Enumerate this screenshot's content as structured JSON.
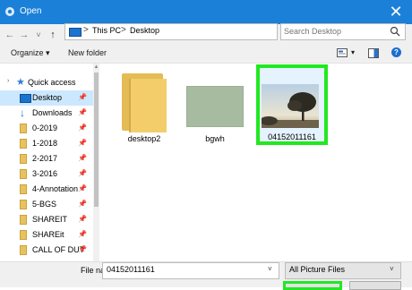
{
  "window": {
    "title": "Open",
    "close_glyph": "✕"
  },
  "nav": {
    "back_glyph": "←",
    "forward_glyph": "→",
    "recent_glyph": "˅",
    "up_glyph": "↑",
    "breadcrumb": [
      "This PC",
      "Desktop"
    ],
    "separator": ">",
    "dropdown_glyph": "˅",
    "refresh_glyph": "↻",
    "search_placeholder": "Search Desktop"
  },
  "toolbar": {
    "organize": "Organize ▾",
    "new_folder": "New folder",
    "view_glyph": "▾",
    "help_glyph": "?"
  },
  "sidebar": {
    "quick_access": "Quick access",
    "items": [
      {
        "label": "Desktop",
        "icon": "desktop-icon",
        "pinned": true
      },
      {
        "label": "Downloads",
        "icon": "download-icon",
        "pinned": true
      },
      {
        "label": "0-2019",
        "icon": "folder-icon",
        "pinned": true
      },
      {
        "label": "1-2018",
        "icon": "folder-icon",
        "pinned": true
      },
      {
        "label": "2-2017",
        "icon": "folder-icon",
        "pinned": true
      },
      {
        "label": "3-2016",
        "icon": "folder-icon",
        "pinned": true
      },
      {
        "label": "4-Annotation",
        "icon": "folder-icon",
        "pinned": true
      },
      {
        "label": "5-BGS",
        "icon": "folder-icon",
        "pinned": true
      },
      {
        "label": "SHAREIT",
        "icon": "folder-icon",
        "pinned": true
      },
      {
        "label": "SHAREit",
        "icon": "folder-icon",
        "pinned": true
      },
      {
        "label": "CALL OF DUT",
        "icon": "folder-icon",
        "pinned": true
      }
    ],
    "pin_glyph": "📌"
  },
  "files": [
    {
      "name": "desktop2",
      "type": "folder"
    },
    {
      "name": "bgwh",
      "type": "image"
    },
    {
      "name": "04152011161",
      "type": "image",
      "selected": true
    }
  ],
  "footer": {
    "filename_label": "File name:",
    "filename_value": "04152011161",
    "filetype_value": "All Picture Files",
    "chevron": "˅"
  },
  "colors": {
    "titlebar": "#1b80d8",
    "highlight": "#21e821",
    "selection": "#cce8ff"
  }
}
